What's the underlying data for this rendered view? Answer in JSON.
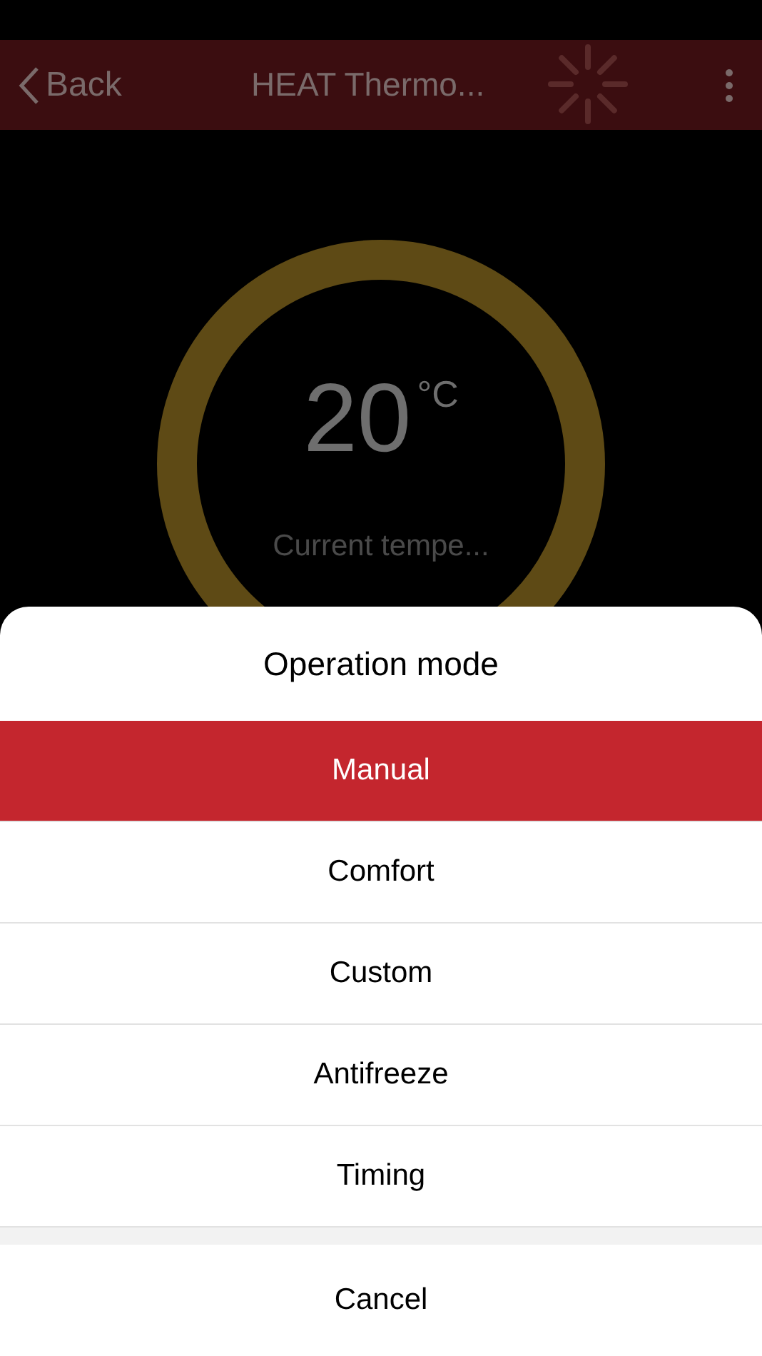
{
  "nav_bar": {
    "back": "Back",
    "title": "HEAT Thermo..."
  },
  "thermostat": {
    "temperature": "20",
    "unit": "°C",
    "caption": "Current tempe..."
  },
  "sheet": {
    "title": "Operation mode",
    "options": [
      {
        "label": "Manual",
        "selected": true
      },
      {
        "label": "Comfort",
        "selected": false
      },
      {
        "label": "Custom",
        "selected": false
      },
      {
        "label": "Antifreeze",
        "selected": false
      },
      {
        "label": "Timing",
        "selected": false
      }
    ],
    "cancel": "Cancel"
  }
}
